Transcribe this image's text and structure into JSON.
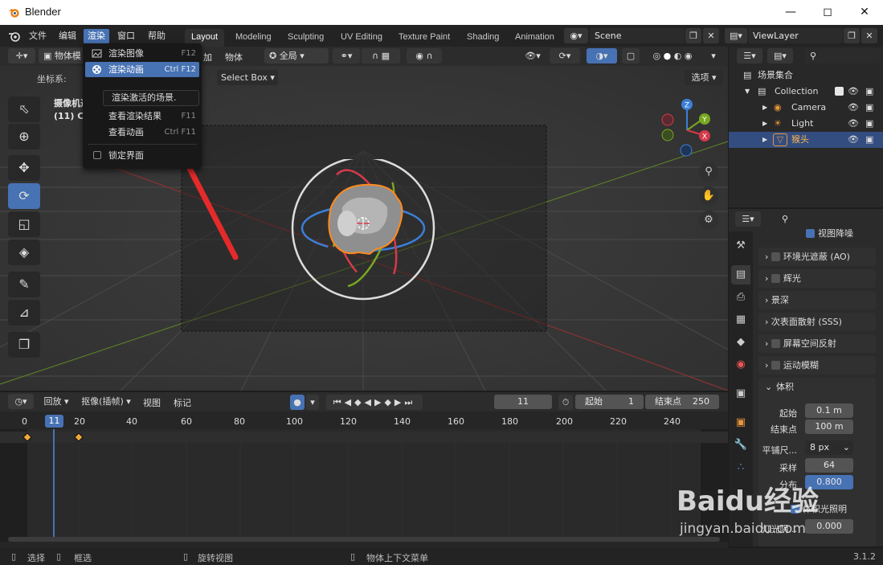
{
  "window": {
    "title": "Blender"
  },
  "menubar": {
    "file": "文件",
    "edit": "编辑",
    "render": "渲染",
    "window": "窗口",
    "help": "帮助"
  },
  "workspaces": [
    "Layout",
    "Modeling",
    "Sculpting",
    "UV Editing",
    "Texture Paint",
    "Shading",
    "Animation"
  ],
  "scene": {
    "name": "Scene"
  },
  "viewlayer": {
    "name": "ViewLayer"
  },
  "viewport_header": {
    "mode": "物体模",
    "add": "加",
    "object": "物体",
    "orientation": "全局"
  },
  "viewport_toolbar": {
    "coords_label": "坐标系:",
    "drag_value": "Select Box",
    "options": "选项"
  },
  "viewport_overlay_text": {
    "line1": "摄像机透",
    "line2": "(11) Co"
  },
  "render_menu": {
    "items": [
      {
        "label": "渲染图像",
        "shortcut": "F12"
      },
      {
        "label": "渲染动画",
        "shortcut": "Ctrl F12"
      },
      {
        "label": "查看渲染结果",
        "shortcut": "F11"
      },
      {
        "label": "查看动画",
        "shortcut": "Ctrl F11"
      },
      {
        "label": "锁定界面",
        "shortcut": ""
      }
    ],
    "tooltip": "渲染激活的场景."
  },
  "outliner": {
    "root": "场景集合",
    "collection": "Collection",
    "items": [
      {
        "name": "Camera"
      },
      {
        "name": "Light"
      },
      {
        "name": "猴头"
      }
    ]
  },
  "properties": {
    "top_checkbox": "视图降噪",
    "panels": [
      "环境光遮蔽 (AO)",
      "辉光",
      "景深",
      "次表面散射 (SSS)",
      "屏幕空间反射",
      "运动模糊"
    ],
    "volumetrics": {
      "title": "体积",
      "start_label": "起始",
      "start_value": "0.1 m",
      "end_label": "结束点",
      "end_value": "100 m",
      "tile_label": "平铺尺...",
      "tile_value": "8 px",
      "samples_label": "采样",
      "samples_value": "64",
      "dist_label": "分布",
      "dist_value": "0.800",
      "lighting_label": "体积光照明",
      "shadow_label": "灯光阴...",
      "shadow_value": "0.000"
    }
  },
  "timeline": {
    "playback": "回放",
    "keying": "抠像(插帧)",
    "view": "视图",
    "marker": "标记",
    "current_frame": "11",
    "start_label": "起始",
    "start_value": "1",
    "end_label": "结束点",
    "end_value": "250",
    "ruler": [
      "0",
      "11",
      "20",
      "40",
      "60",
      "80",
      "100",
      "120",
      "140",
      "160",
      "180",
      "200",
      "220",
      "240"
    ],
    "keyframes": [
      0,
      20
    ]
  },
  "statusbar": {
    "select": "选择",
    "box_select": "框选",
    "rotate_view": "旋转视图",
    "context_menu": "物体上下文菜单",
    "version": "3.1.2"
  },
  "watermark": {
    "brand": "Baidu经验",
    "url": "jingyan.baidu.com"
  }
}
